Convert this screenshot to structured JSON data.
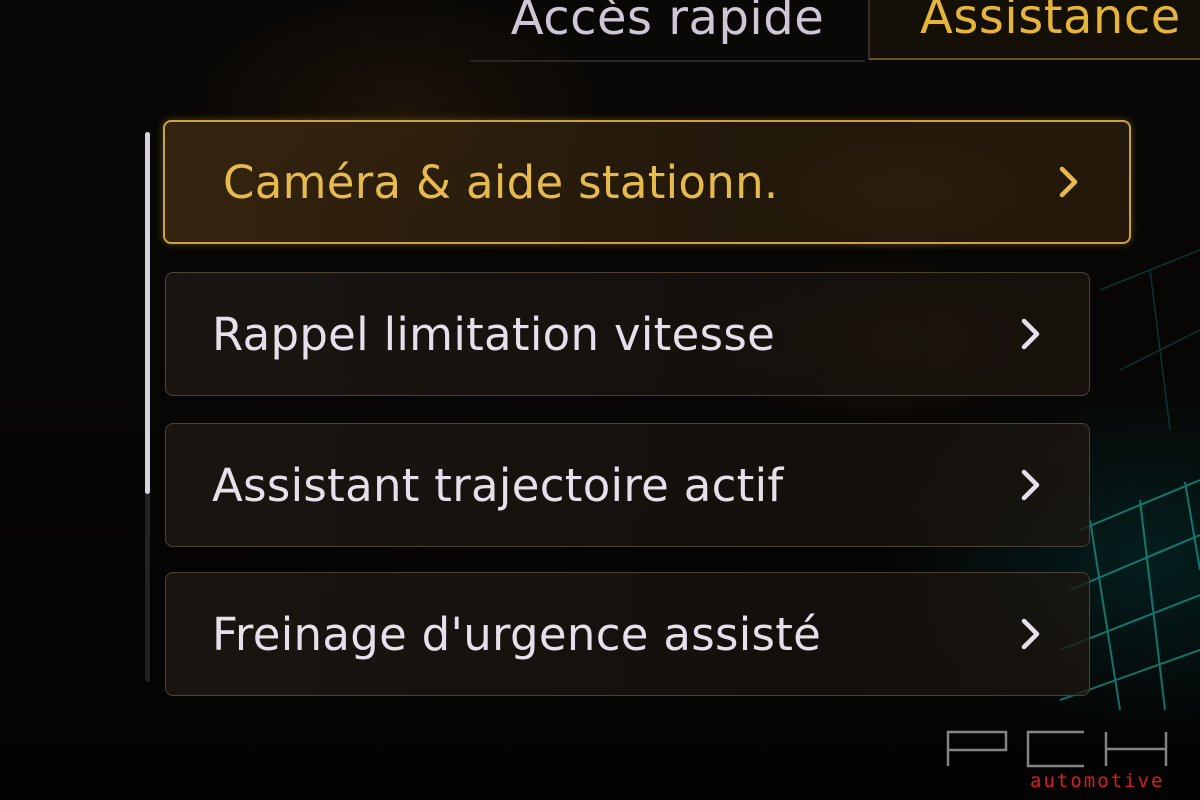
{
  "tabs": [
    {
      "label": "Accès rapide",
      "active": false
    },
    {
      "label": "Assistance",
      "active": true
    }
  ],
  "menu": {
    "items": [
      {
        "label": "Caméra & aide stationn.",
        "selected": true,
        "chevron": "chevron-right-icon"
      },
      {
        "label": "Rappel limitation vitesse",
        "selected": false,
        "chevron": "chevron-right-icon"
      },
      {
        "label": "Assistant trajectoire actif",
        "selected": false,
        "chevron": "chevron-right-icon"
      },
      {
        "label": "Freinage d'urgence assisté",
        "selected": false,
        "chevron": "chevron-right-icon"
      }
    ]
  },
  "watermark": {
    "brand": "PCH",
    "word": "automotive"
  },
  "colors": {
    "accent": "#e6bb4c",
    "text": "#e6e0ea",
    "logo_red": "#d81e1e"
  }
}
